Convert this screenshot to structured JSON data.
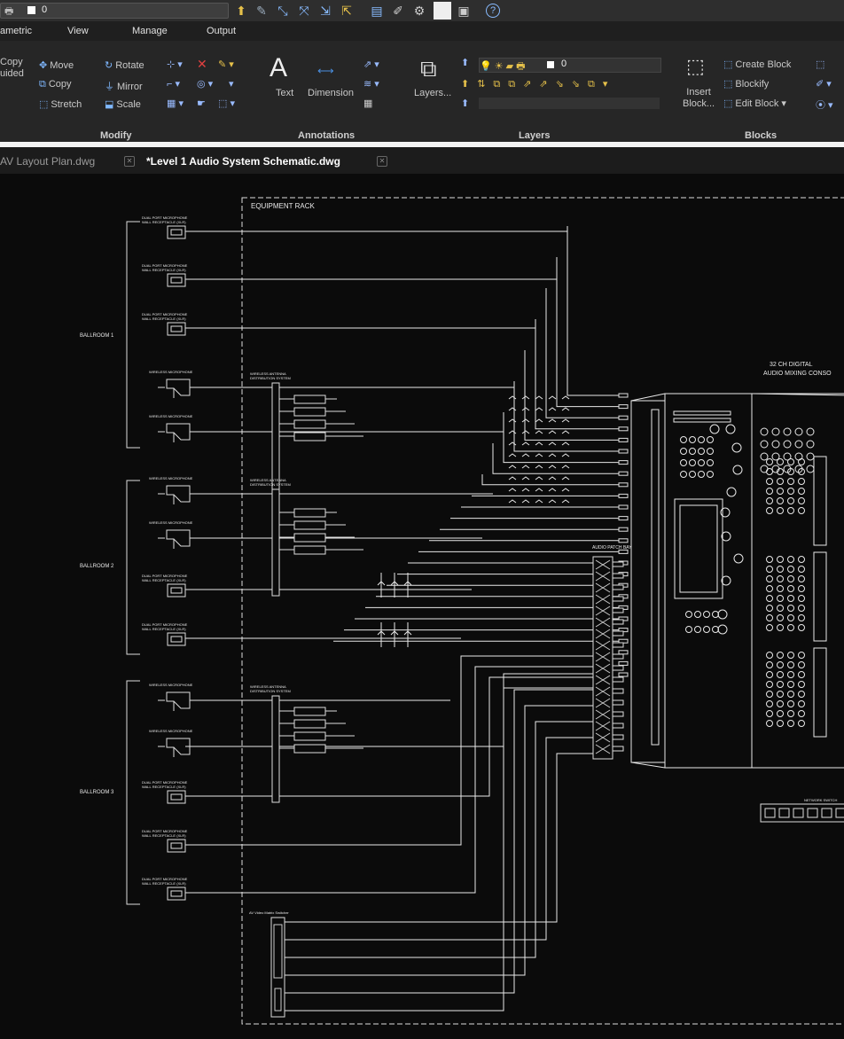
{
  "quick_access": {
    "layer_value": "0"
  },
  "menu": [
    {
      "label": "ametric"
    },
    {
      "label": "View"
    },
    {
      "label": "Manage"
    },
    {
      "label": "Output"
    }
  ],
  "modify": {
    "copy_guided": "Copy\nuided",
    "move": "Move",
    "copy": "Copy",
    "stretch": "Stretch",
    "rotate": "Rotate",
    "mirror": "Mirror",
    "scale": "Scale",
    "title": "Modify"
  },
  "annotations": {
    "text": "Text",
    "dimension": "Dimension",
    "title": "Annotations"
  },
  "layers": {
    "layers_btn": "Layers...",
    "current_layer": "0",
    "title": "Layers"
  },
  "blocks": {
    "insert": "Insert\nBlock...",
    "create": "Create Block",
    "blockify": "Blockify",
    "edit": "Edit Block",
    "title": "Blocks"
  },
  "tabs": [
    {
      "label": "AV Layout Plan.dwg",
      "active": false
    },
    {
      "label": "*Level 1 Audio System Schematic.dwg",
      "active": true
    }
  ],
  "drawing": {
    "equipment_rack": "EQUIPMENT RACK",
    "ballrooms": [
      "BALLROOM 1",
      "BALLROOM 2",
      "BALLROOM 3"
    ],
    "dual_mic": "DUAL PORT MICROPHONE\nWALL RECEPTACLE (XLR)",
    "wireless_mic": "WIRELESS MICROPHONE",
    "antenna": "WIRELESS ANTENNA\nDISTRIBUTION SYSTEM",
    "patch_bay": "AUDIO\nPATCH BAY",
    "console": "32 CH DIGITAL\nAUDIO MIXING CONSO",
    "switcher": "AV Video Matrix Switcher",
    "network": "NETWORK SWITCH"
  }
}
